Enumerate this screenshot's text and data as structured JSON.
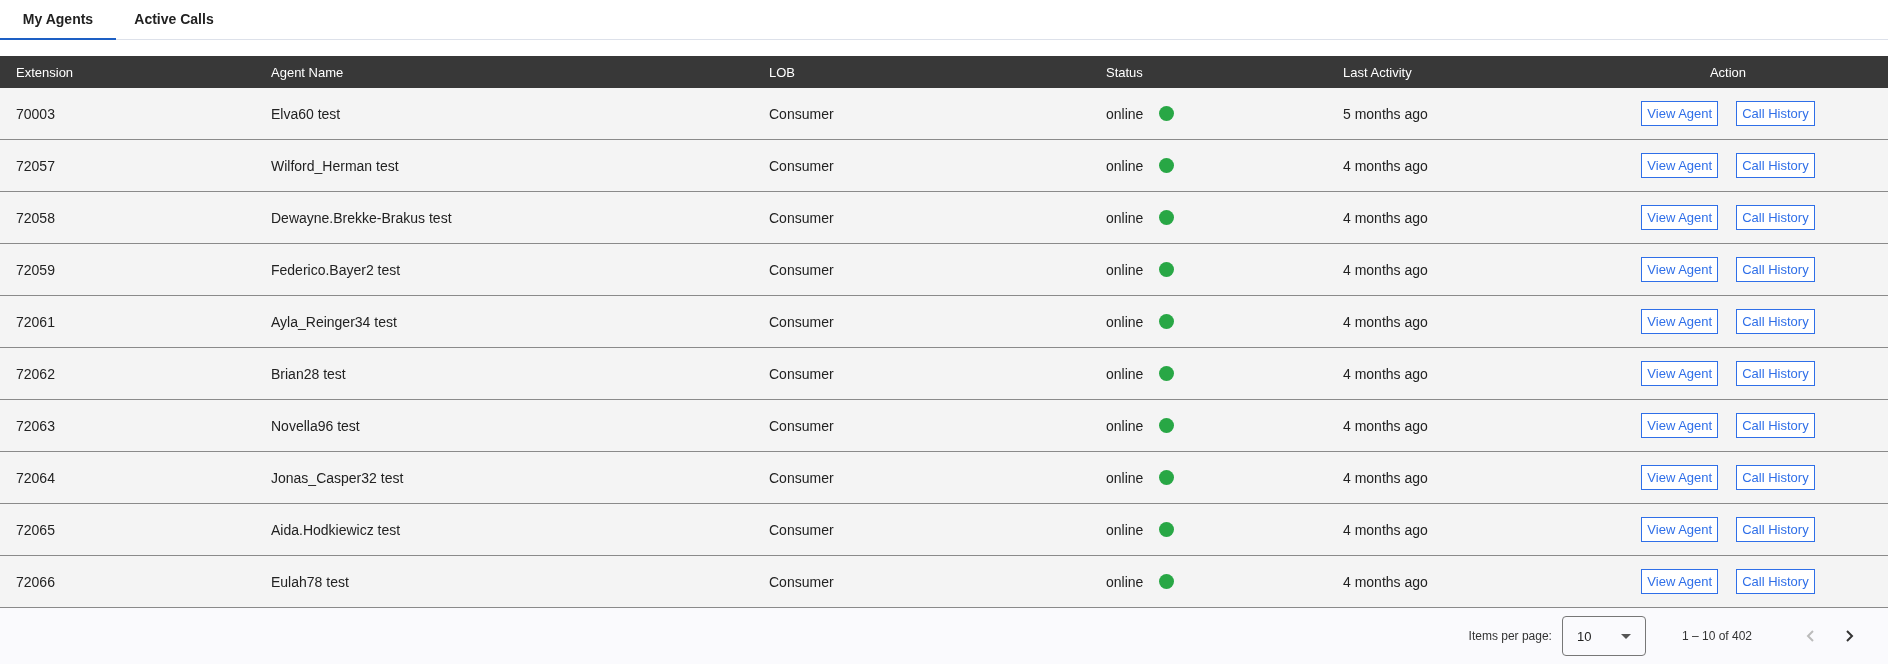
{
  "tabs": [
    {
      "label": "My Agents",
      "selected": true
    },
    {
      "label": "Active Calls",
      "selected": false
    }
  ],
  "table": {
    "columns": [
      "Extension",
      "Agent Name",
      "LOB",
      "Status",
      "Last Activity",
      "Action"
    ],
    "rows": [
      {
        "extension": "70003",
        "agent_name": "Elva60 test",
        "lob": "Consumer",
        "status": "online",
        "color": "#28a745",
        "last_activity": "5 months ago",
        "actions": [
          "View Agent",
          "Call History"
        ]
      },
      {
        "extension": "72057",
        "agent_name": "Wilford_Herman test",
        "lob": "Consumer",
        "status": "online",
        "color": "#28a745",
        "last_activity": "4 months ago",
        "actions": [
          "View Agent",
          "Call History"
        ]
      },
      {
        "extension": "72058",
        "agent_name": "Dewayne.Brekke-Brakus test",
        "lob": "Consumer",
        "status": "online",
        "color": "#28a745",
        "last_activity": "4 months ago",
        "actions": [
          "View Agent",
          "Call History"
        ]
      },
      {
        "extension": "72059",
        "agent_name": "Federico.Bayer2 test",
        "lob": "Consumer",
        "status": "online",
        "color": "#28a745",
        "last_activity": "4 months ago",
        "actions": [
          "View Agent",
          "Call History"
        ]
      },
      {
        "extension": "72061",
        "agent_name": "Ayla_Reinger34 test",
        "lob": "Consumer",
        "status": "online",
        "color": "#28a745",
        "last_activity": "4 months ago",
        "actions": [
          "View Agent",
          "Call History"
        ]
      },
      {
        "extension": "72062",
        "agent_name": "Brian28 test",
        "lob": "Consumer",
        "status": "online",
        "color": "#28a745",
        "last_activity": "4 months ago",
        "actions": [
          "View Agent",
          "Call History"
        ]
      },
      {
        "extension": "72063",
        "agent_name": "Novella96 test",
        "lob": "Consumer",
        "status": "online",
        "color": "#28a745",
        "last_activity": "4 months ago",
        "actions": [
          "View Agent",
          "Call History"
        ]
      },
      {
        "extension": "72064",
        "agent_name": "Jonas_Casper32 test",
        "lob": "Consumer",
        "status": "online",
        "color": "#28a745",
        "last_activity": "4 months ago",
        "actions": [
          "View Agent",
          "Call History"
        ]
      },
      {
        "extension": "72065",
        "agent_name": "Aida.Hodkiewicz test",
        "lob": "Consumer",
        "status": "online",
        "color": "#28a745",
        "last_activity": "4 months ago",
        "actions": [
          "View Agent",
          "Call History"
        ]
      },
      {
        "extension": "72066",
        "agent_name": "Eulah78 test",
        "lob": "Consumer",
        "status": "online",
        "color": "#28a745",
        "last_activity": "4 months ago",
        "actions": [
          "View Agent",
          "Call History"
        ]
      }
    ]
  },
  "paginator": {
    "items_per_page_label": "Items per page:",
    "page_size": "10",
    "range": "1 – 10 of 402",
    "previous_disabled": true,
    "next_disabled": false
  }
}
